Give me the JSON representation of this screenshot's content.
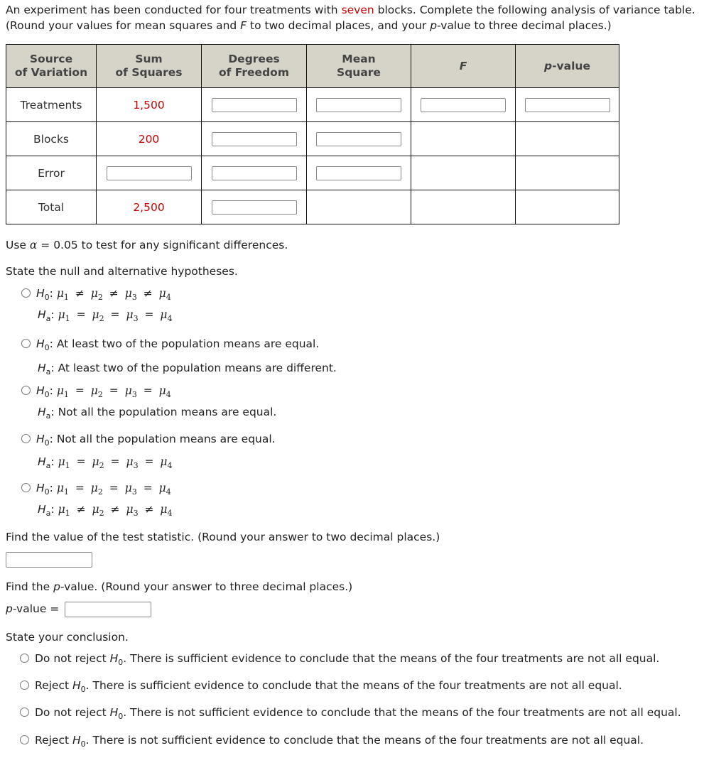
{
  "intro": {
    "part1": "An experiment has been conducted for four treatments with ",
    "highlight": "seven",
    "part2": " blocks. Complete the following analysis of variance table.",
    "line2_a": "(Round your values for mean squares and ",
    "line2_F": "F",
    "line2_b": " to two decimal places, and your ",
    "line2_p": "p",
    "line2_c": "-value to three decimal places.)"
  },
  "colors": {
    "given_value": "#cc0000",
    "header_bg": "#d6d3c9"
  },
  "table": {
    "headers": {
      "source": [
        "Source",
        "of Variation"
      ],
      "ss": [
        "Sum",
        "of Squares"
      ],
      "df": [
        "Degrees",
        "of Freedom"
      ],
      "ms": [
        "Mean",
        "Square"
      ],
      "f": "F",
      "p_italic": "p",
      "p_rest": "-value"
    },
    "rows": [
      {
        "source": "Treatments",
        "ss": "1,500",
        "df": "",
        "ms": "",
        "f": "",
        "p": ""
      },
      {
        "source": "Blocks",
        "ss": "200",
        "df": "",
        "ms": ""
      },
      {
        "source": "Error",
        "ss": "",
        "df": "",
        "ms": ""
      },
      {
        "source": "Total",
        "ss": "2,500",
        "df": ""
      }
    ]
  },
  "alpha_line": {
    "a": "Use ",
    "alpha": "α",
    "b": " = 0.05 to test for any significant differences."
  },
  "hypotheses_prompt": "State the null and alternative hypotheses.",
  "hypotheses": [
    {
      "h0": "μ1 ≠ μ2 ≠ μ3 ≠ μ4",
      "ha": "μ1 = μ2 = μ3 = μ4"
    },
    {
      "h0": "At least two of the population means are equal.",
      "ha": "At least two of the population means are different."
    },
    {
      "h0": "μ1 = μ2 = μ3 = μ4",
      "ha": "Not all the population means are equal."
    },
    {
      "h0": "Not all the population means are equal.",
      "ha": "μ1 = μ2 = μ3 = μ4"
    },
    {
      "h0": "μ1 = μ2 = μ3 = μ4",
      "ha": "μ1 ≠ μ2 ≠ μ3 ≠ μ4"
    }
  ],
  "test_statistic_prompt": "Find the value of the test statistic. (Round your answer to two decimal places.)",
  "test_statistic_value": "",
  "pvalue_prompt": {
    "a": "Find the ",
    "p": "p",
    "b": "-value. (Round your answer to three decimal places.)"
  },
  "pvalue_label": {
    "p": "p",
    "rest": "-value ="
  },
  "pvalue_value": "",
  "conclusion_prompt": "State your conclusion.",
  "conclusions": [
    {
      "lead": "Do not reject ",
      "rest": ". There is sufficient evidence to conclude that the means of the four treatments are not all equal."
    },
    {
      "lead": "Reject ",
      "rest": ". There is sufficient evidence to conclude that the means of the four treatments are not all equal."
    },
    {
      "lead": "Do not reject ",
      "rest": ". There is not sufficient evidence to conclude that the means of the four treatments are not all equal."
    },
    {
      "lead": "Reject ",
      "rest": ". There is not sufficient evidence to conclude that the means of the four treatments are not all equal."
    }
  ],
  "symbols": {
    "H": "H",
    "sub0": "0",
    "suba": "a",
    "colon": ":"
  }
}
